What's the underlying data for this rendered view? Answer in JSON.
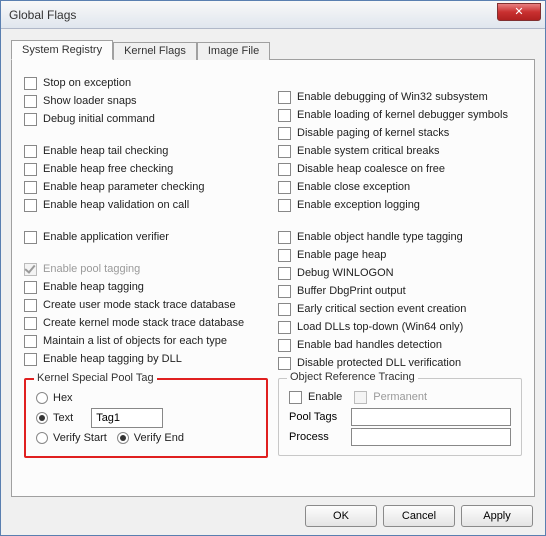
{
  "window": {
    "title": "Global Flags"
  },
  "tabs": [
    {
      "label": "System Registry",
      "active": true
    },
    {
      "label": "Kernel Flags",
      "active": false
    },
    {
      "label": "Image File",
      "active": false
    }
  ],
  "left_checks": [
    {
      "label": "Stop on exception",
      "checked": false
    },
    {
      "label": "Show loader snaps",
      "checked": false
    },
    {
      "label": "Debug initial command",
      "checked": false
    },
    null,
    {
      "label": "Enable heap tail checking",
      "checked": false
    },
    {
      "label": "Enable heap free checking",
      "checked": false
    },
    {
      "label": "Enable heap parameter checking",
      "checked": false
    },
    {
      "label": "Enable heap validation on call",
      "checked": false
    },
    null,
    {
      "label": "Enable application verifier",
      "checked": false
    },
    null,
    {
      "label": "Enable pool tagging",
      "checked": true,
      "disabled": true
    },
    {
      "label": "Enable heap tagging",
      "checked": false
    },
    {
      "label": "Create user mode stack trace database",
      "checked": false
    },
    {
      "label": "Create kernel mode stack trace database",
      "checked": false
    },
    {
      "label": "Maintain a list of objects for each type",
      "checked": false
    },
    {
      "label": "Enable heap tagging by DLL",
      "checked": false
    }
  ],
  "right_checks": [
    null,
    {
      "label": "Enable debugging of Win32 subsystem",
      "checked": false
    },
    {
      "label": "Enable loading of kernel debugger symbols",
      "checked": false
    },
    {
      "label": "Disable paging of kernel stacks",
      "checked": false
    },
    {
      "label": "Enable system critical breaks",
      "checked": false
    },
    {
      "label": "Disable heap coalesce on free",
      "checked": false
    },
    {
      "label": "Enable close exception",
      "checked": false
    },
    {
      "label": "Enable exception logging",
      "checked": false
    },
    null,
    {
      "label": "Enable object handle type tagging",
      "checked": false
    },
    {
      "label": "Enable page heap",
      "checked": false
    },
    {
      "label": "Debug WINLOGON",
      "checked": false
    },
    {
      "label": "Buffer DbgPrint output",
      "checked": false
    },
    {
      "label": "Early critical section event creation",
      "checked": false
    },
    {
      "label": "Load DLLs top-down (Win64 only)",
      "checked": false
    },
    {
      "label": "Enable bad handles detection",
      "checked": false
    },
    {
      "label": "Disable protected DLL verification",
      "checked": false
    }
  ],
  "kspt": {
    "legend": "Kernel Special Pool Tag",
    "hex": "Hex",
    "text": "Text",
    "verify_start": "Verify Start",
    "verify_end": "Verify End",
    "value": "Tag1",
    "mode_selected": "text",
    "verify_selected": "end"
  },
  "ort": {
    "legend": "Object Reference Tracing",
    "enable": "Enable",
    "permanent": "Permanent",
    "pool_tags": "Pool Tags",
    "process": "Process",
    "pool_tags_value": "",
    "process_value": ""
  },
  "buttons": {
    "ok": "OK",
    "cancel": "Cancel",
    "apply": "Apply"
  },
  "close_glyph": "✕"
}
